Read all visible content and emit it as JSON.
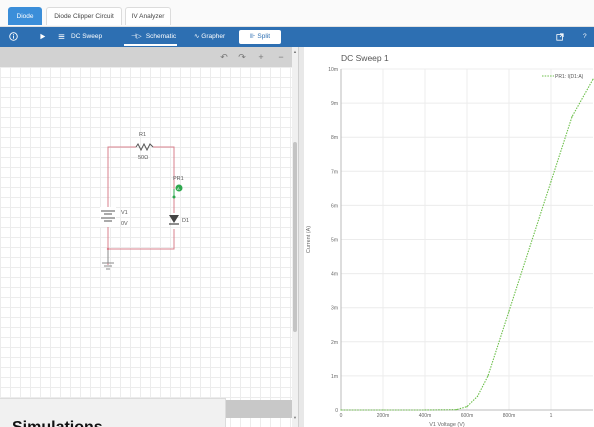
{
  "tabs": [
    {
      "label": "Diode"
    },
    {
      "label": "Diode Clipper Circuit"
    },
    {
      "label": "IV Analyzer"
    }
  ],
  "toolbar": {
    "info_icon": "info-icon",
    "play_icon": "play-icon",
    "menu_icon": "menu-icon",
    "analysis_label": "DC Sweep",
    "schematic_label": "Schematic",
    "grapher_label": "Grapher",
    "split_label": "Split",
    "export_icon": "export-icon",
    "help_label": "?"
  },
  "schematic_tools": {
    "undo": "↶",
    "redo": "↷",
    "zoom_in": "+",
    "zoom_out": "−"
  },
  "circuit": {
    "r1_name": "R1",
    "r1_value": "50Ω",
    "v1_name": "V1",
    "v1_value": "0V",
    "d1_name": "D1",
    "probe_name": "PR1",
    "wire_color": "#d9808c",
    "probe_color": "#2fa84f"
  },
  "overlay": {
    "text": "Simulations"
  },
  "chart_data": {
    "type": "line",
    "title": "DC Sweep 1",
    "xlabel": "V1 Voltage (V)",
    "ylabel": "Current (A)",
    "x_ticks": [
      "0",
      "200m",
      "400m",
      "600m",
      "800m",
      "1"
    ],
    "y_ticks": [
      "0",
      "1m",
      "2m",
      "3m",
      "4m",
      "5m",
      "6m",
      "7m",
      "8m",
      "9m",
      "10m"
    ],
    "xlim": [
      0,
      1.2
    ],
    "ylim": [
      0,
      0.01
    ],
    "grid": true,
    "legend_position": "top-right",
    "series": [
      {
        "name": "PR1: I(D1:A)",
        "color": "#6cbf4a",
        "x": [
          0,
          0.2,
          0.4,
          0.55,
          0.6,
          0.65,
          0.7,
          0.8,
          0.9,
          1.0,
          1.1,
          1.2
        ],
        "y": [
          0,
          0,
          0,
          1e-05,
          0.0001,
          0.0004,
          0.001,
          0.0029,
          0.0048,
          0.0067,
          0.0086,
          0.0097
        ]
      }
    ]
  }
}
